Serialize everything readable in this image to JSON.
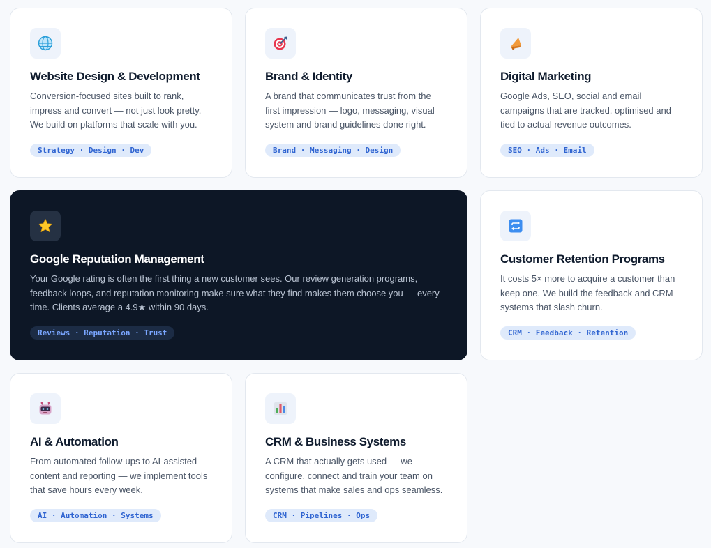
{
  "services": [
    {
      "id": "web",
      "icon": "globe-icon",
      "title": "Website Design & Development",
      "description": "Conversion-focused sites built to rank, impress and convert — not just look pretty. We build on platforms that scale with you.",
      "tags": "Strategy · Design · Dev"
    },
    {
      "id": "brand",
      "icon": "target-icon",
      "title": "Brand & Identity",
      "description": "A brand that communicates trust from the first impression — logo, messaging, visual system and brand guidelines done right.",
      "tags": "Brand · Messaging · Design"
    },
    {
      "id": "marketing",
      "icon": "megaphone-icon",
      "title": "Digital Marketing",
      "description": "Google Ads, SEO, social and email campaigns that are tracked, optimised and tied to actual revenue outcomes.",
      "tags": "SEO · Ads · Email"
    },
    {
      "id": "reputation",
      "icon": "star-icon",
      "title": "Google Reputation Management",
      "description": "Your Google rating is often the first thing a new customer sees. Our review generation programs, feedback loops, and reputation monitoring make sure what they find makes them choose you — every time. Clients average a 4.9★ within 90 days.",
      "tags": "Reviews · Reputation · Trust",
      "featured": true
    },
    {
      "id": "retention",
      "icon": "repeat-icon",
      "title": "Customer Retention Programs",
      "description": "It costs 5× more to acquire a customer than keep one. We build the feedback and CRM systems that slash churn.",
      "tags": "CRM · Feedback · Retention"
    },
    {
      "id": "ai",
      "icon": "robot-icon",
      "title": "AI & Automation",
      "description": "From automated follow-ups to AI-assisted content and reporting — we implement tools that save hours every week.",
      "tags": "AI · Automation · Systems"
    },
    {
      "id": "crm",
      "icon": "bar-chart-icon",
      "title": "CRM & Business Systems",
      "description": "A CRM that actually gets used — we configure, connect and train your team on systems that make sales and ops seamless.",
      "tags": "CRM · Pipelines · Ops"
    }
  ],
  "colors": {
    "page_background": "#f7f9fc",
    "card_background": "#ffffff",
    "featured_background": "#0d1726",
    "tag_background": "#dfeafb",
    "tag_text": "#2f64d1",
    "title_text": "#0f1b2d"
  }
}
